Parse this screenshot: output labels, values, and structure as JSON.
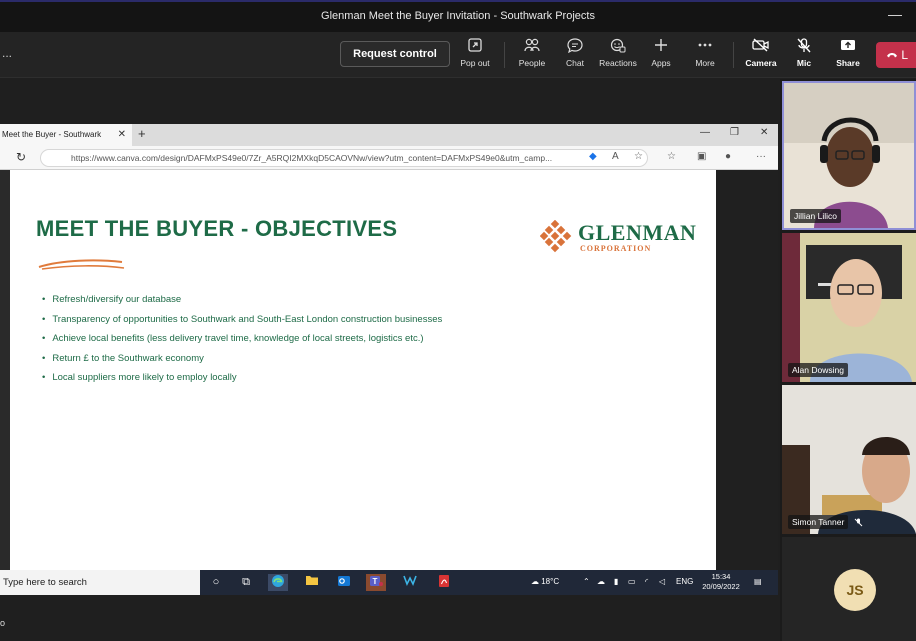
{
  "window": {
    "title": "Glenman Meet the Buyer Invitation - Southwark Projects",
    "minimize": "—"
  },
  "toolbar": {
    "more_dots": "...",
    "request_control": "Request control",
    "items": [
      {
        "label": "Pop out",
        "icon": "pop-out-icon"
      },
      {
        "label": "People",
        "icon": "people-icon"
      },
      {
        "label": "Chat",
        "icon": "chat-icon"
      },
      {
        "label": "Reactions",
        "icon": "reactions-icon"
      },
      {
        "label": "Apps",
        "icon": "plus-icon"
      },
      {
        "label": "More",
        "icon": "ellipsis-icon"
      },
      {
        "label": "Camera",
        "icon": "camera-off-icon"
      },
      {
        "label": "Mic",
        "icon": "mic-off-icon"
      },
      {
        "label": "Share",
        "icon": "share-icon"
      }
    ],
    "leave_label": "L",
    "leave_color": "#c4314b"
  },
  "browser": {
    "tab_title": "Meet the Buyer - Southwark",
    "url": "https://www.canva.com/design/DAFMxPS49e0/7Zr_A5RQI2MXkqD5CAOVNw/view?utm_content=DAFMxPS49e0&utm_camp..."
  },
  "slide": {
    "title": "MEET THE BUYER - OBJECTIVES",
    "logo_name": "GLENMAN",
    "logo_sub": "CORPORATION",
    "brand_green": "#1e6b47",
    "brand_orange": "#d9733a",
    "bullets": [
      "Refresh/diversify our database",
      "Transparency of opportunities to Southwark and South-East London construction businesses",
      "Achieve local benefits (less delivery travel time, knowledge of local streets, logistics etc.)",
      "Return £ to the Southwark economy",
      "Local suppliers more likely to employ locally"
    ]
  },
  "taskbar": {
    "search_placeholder": "Type here to search",
    "weather": "18°C",
    "language": "ENG",
    "time": "15:34",
    "date": "20/09/2022"
  },
  "participants": [
    {
      "name": "Jillian Lilico",
      "active_speaker": true,
      "muted": false
    },
    {
      "name": "Alan Dowsing",
      "active_speaker": false,
      "muted": false
    },
    {
      "name": "Simon Tanner",
      "active_speaker": false,
      "muted": true
    },
    {
      "initials": "JS"
    }
  ],
  "left_edge_label": "o"
}
